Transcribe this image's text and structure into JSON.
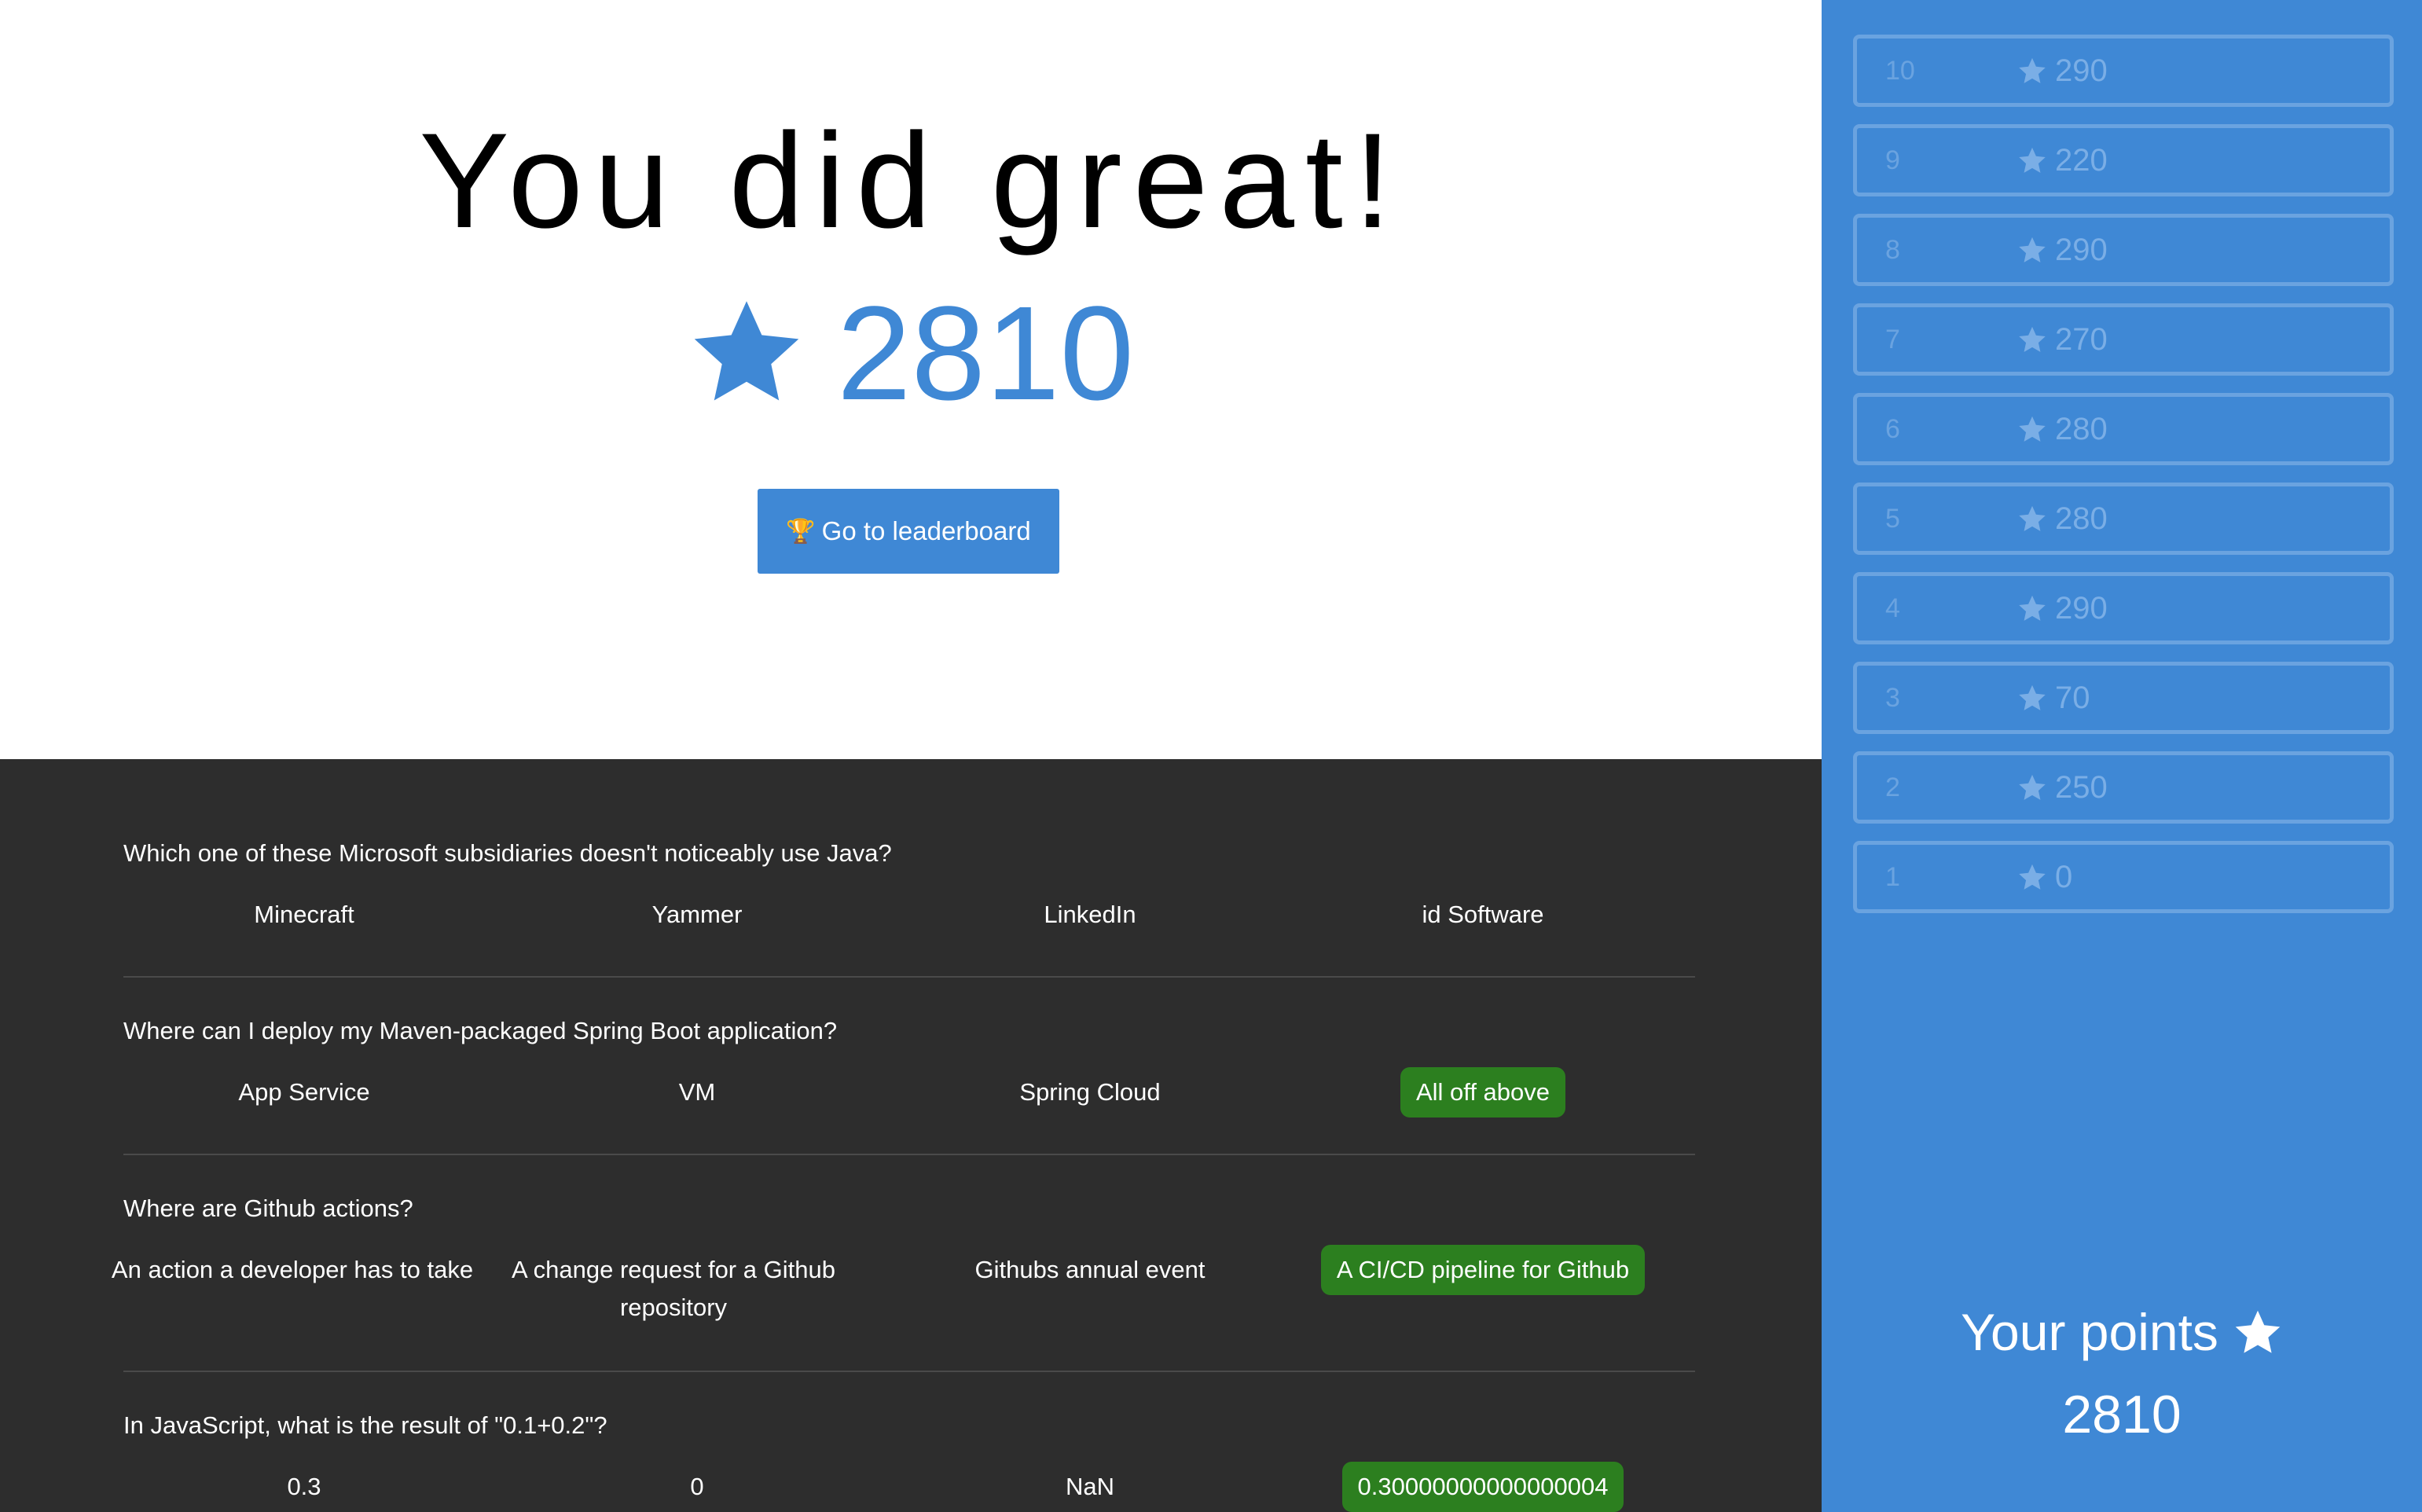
{
  "hero": {
    "title": "You did great!",
    "score": "2810",
    "star_icon": "star-icon",
    "leaderboard_button": "Go to leaderboard",
    "trophy_icon": "🏆"
  },
  "colors": {
    "accent": "#3f88d5",
    "dark_bg": "#2d2d2d",
    "correct": "#2c7f1f",
    "round_border": "#6aa3e0"
  },
  "questions": [
    {
      "text": "Which one of these Microsoft subsidiaries doesn't noticeably use Java?",
      "answers": [
        {
          "text": "Minecraft",
          "correct": false
        },
        {
          "text": "Yammer",
          "correct": false
        },
        {
          "text": "LinkedIn",
          "correct": false
        },
        {
          "text": "id Software",
          "correct": false
        }
      ]
    },
    {
      "text": "Where can I deploy my Maven-packaged Spring Boot application?",
      "answers": [
        {
          "text": "App Service",
          "correct": false
        },
        {
          "text": "VM",
          "correct": false
        },
        {
          "text": "Spring Cloud",
          "correct": false
        },
        {
          "text": "All off above",
          "correct": true
        }
      ]
    },
    {
      "text": "Where are Github actions?",
      "answers": [
        {
          "text": "An action a developer has to take",
          "correct": false
        },
        {
          "text": "A change request for a Github repository",
          "correct": false
        },
        {
          "text": "Githubs annual event",
          "correct": false
        },
        {
          "text": "A CI/CD pipeline for Github",
          "correct": true
        }
      ]
    },
    {
      "text": "In JavaScript, what is the result of \"0.1+0.2\"?",
      "answers": [
        {
          "text": "0.3",
          "correct": false
        },
        {
          "text": "0",
          "correct": false
        },
        {
          "text": "NaN",
          "correct": false
        },
        {
          "text": "0.30000000000000004",
          "correct": true
        }
      ]
    }
  ],
  "sidebar": {
    "rounds": [
      {
        "number": "10",
        "points": "290"
      },
      {
        "number": "9",
        "points": "220"
      },
      {
        "number": "8",
        "points": "290"
      },
      {
        "number": "7",
        "points": "270"
      },
      {
        "number": "6",
        "points": "280"
      },
      {
        "number": "5",
        "points": "280"
      },
      {
        "number": "4",
        "points": "290"
      },
      {
        "number": "3",
        "points": "70"
      },
      {
        "number": "2",
        "points": "250"
      },
      {
        "number": "1",
        "points": "0"
      }
    ],
    "your_points_label": "Your points",
    "your_points_value": "2810"
  }
}
